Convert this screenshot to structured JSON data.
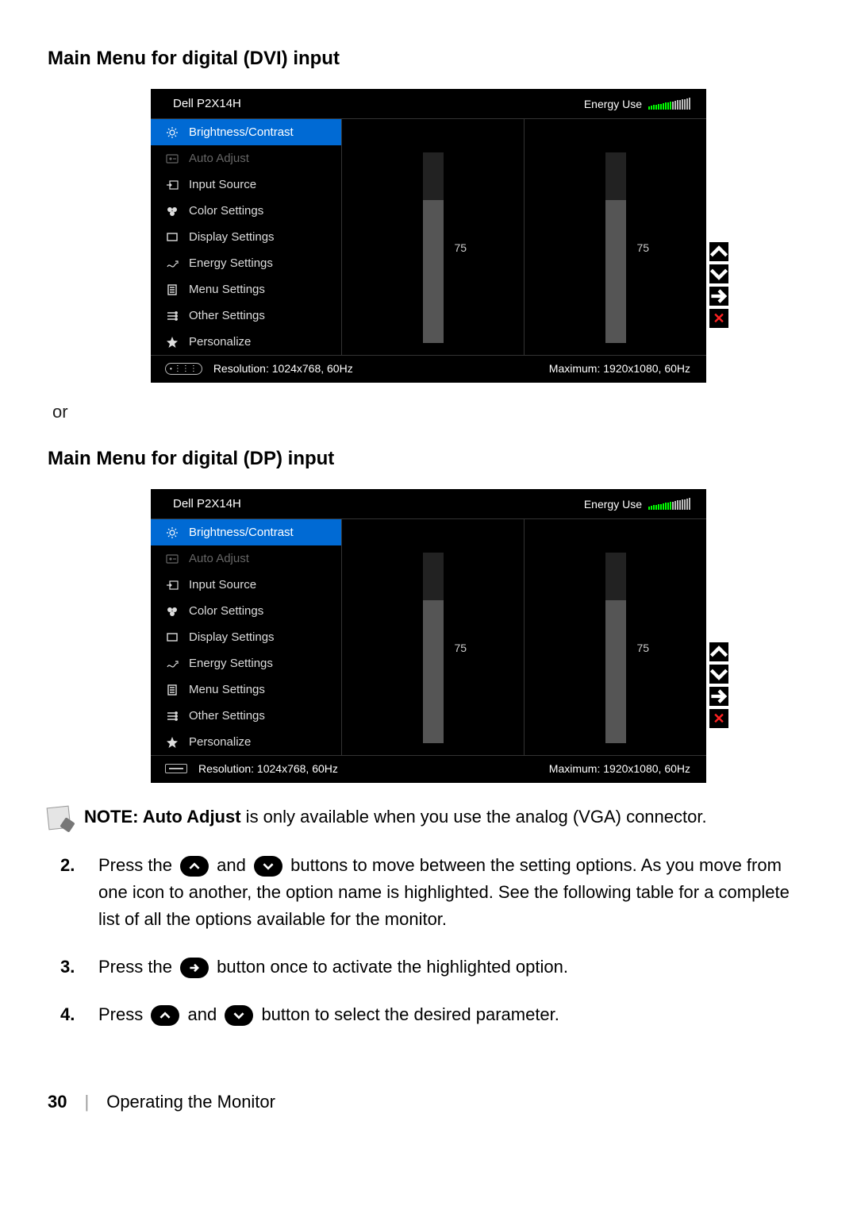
{
  "headings": {
    "dvi": "Main Menu for digital (DVI) input",
    "dp": "Main Menu for digital (DP) input",
    "or": "or"
  },
  "osd": {
    "title": "Dell P2X14H",
    "energy_label": "Energy Use",
    "menu": [
      {
        "key": "brightness",
        "label": "Brightness/Contrast",
        "selected": true
      },
      {
        "key": "autoadjust",
        "label": "Auto Adjust",
        "disabled": true
      },
      {
        "key": "input",
        "label": "Input Source"
      },
      {
        "key": "color",
        "label": "Color Settings"
      },
      {
        "key": "display",
        "label": "Display Settings"
      },
      {
        "key": "energy",
        "label": "Energy Settings"
      },
      {
        "key": "menu",
        "label": "Menu Settings"
      },
      {
        "key": "other",
        "label": "Other Settings"
      },
      {
        "key": "personalize",
        "label": "Personalize"
      }
    ],
    "brightness_value": "75",
    "contrast_value": "75",
    "resolution": "Resolution: 1024x768, 60Hz",
    "maximum": "Maximum: 1920x1080, 60Hz"
  },
  "note": {
    "bold": "NOTE: Auto Adjust",
    "rest": " is only available when you use the analog (VGA) connector."
  },
  "steps": {
    "s2_num": "2.",
    "s2a": "Press the ",
    "s2b": " and ",
    "s2c": " buttons to move between the setting options. As you move from one icon to another, the option name is highlighted. See the following table for a complete list of all the options available for the monitor.",
    "s3_num": "3.",
    "s3a": "Press the ",
    "s3b": " button once to activate the highlighted option.",
    "s4_num": "4.",
    "s4a": "Press ",
    "s4b": " and ",
    "s4c": " button to select the desired parameter."
  },
  "footer": {
    "page": "30",
    "section": "Operating the Monitor"
  },
  "chart_data": [
    {
      "type": "bar",
      "title": "Brightness",
      "categories": [
        "Brightness"
      ],
      "values": [
        75
      ],
      "ylim": [
        0,
        100
      ]
    },
    {
      "type": "bar",
      "title": "Contrast",
      "categories": [
        "Contrast"
      ],
      "values": [
        75
      ],
      "ylim": [
        0,
        100
      ]
    }
  ]
}
